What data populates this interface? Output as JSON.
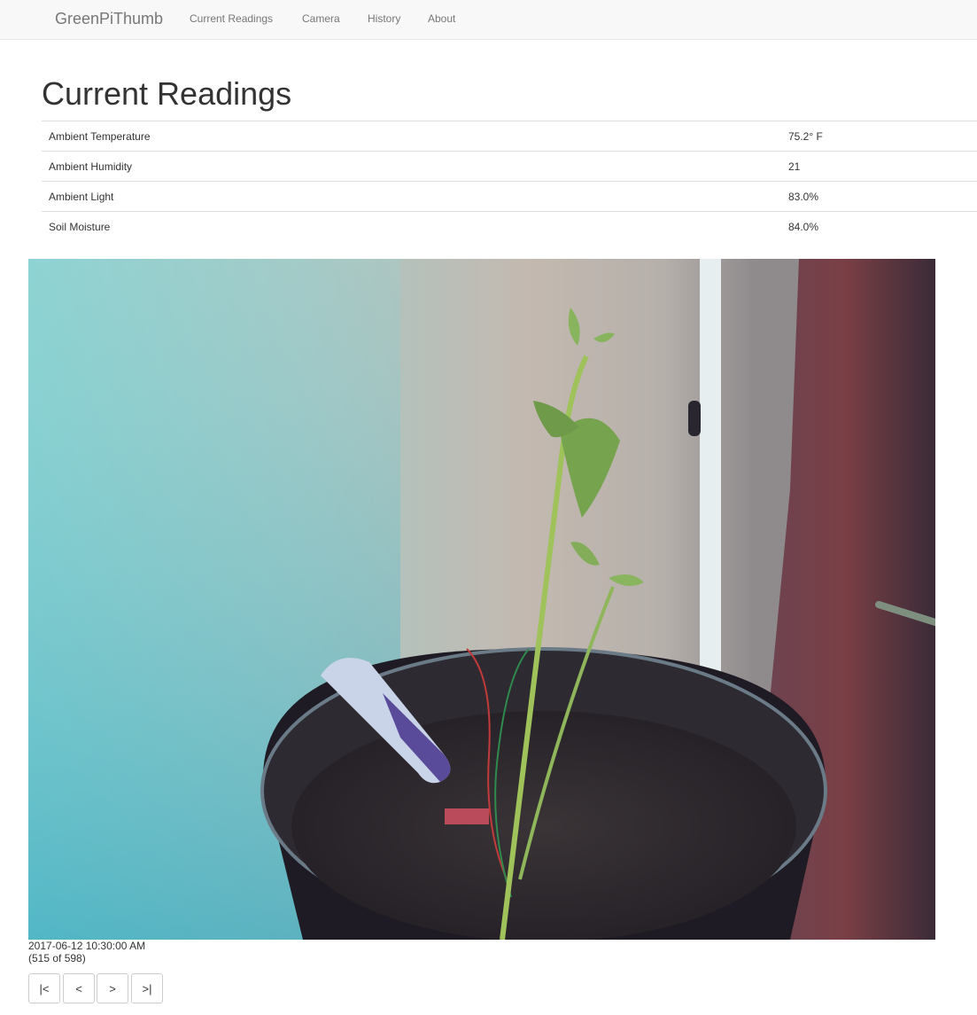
{
  "navbar": {
    "brand": "GreenPiThumb",
    "links": [
      "Current Readings",
      "Camera",
      "History",
      "About"
    ]
  },
  "page_title": "Current Readings",
  "readings": [
    {
      "label": "Ambient Temperature",
      "value": "75.2° F"
    },
    {
      "label": "Ambient Humidity",
      "value": "21"
    },
    {
      "label": "Ambient Light",
      "value": "83.0%"
    },
    {
      "label": "Soil Moisture",
      "value": "84.0%"
    }
  ],
  "camera": {
    "image_description": "plant-photo",
    "timestamp": "2017-06-12 10:30:00 AM",
    "counter": "(515 of 598)"
  },
  "pager": {
    "first": "|<",
    "prev": "<",
    "next": ">",
    "last": ">|"
  }
}
